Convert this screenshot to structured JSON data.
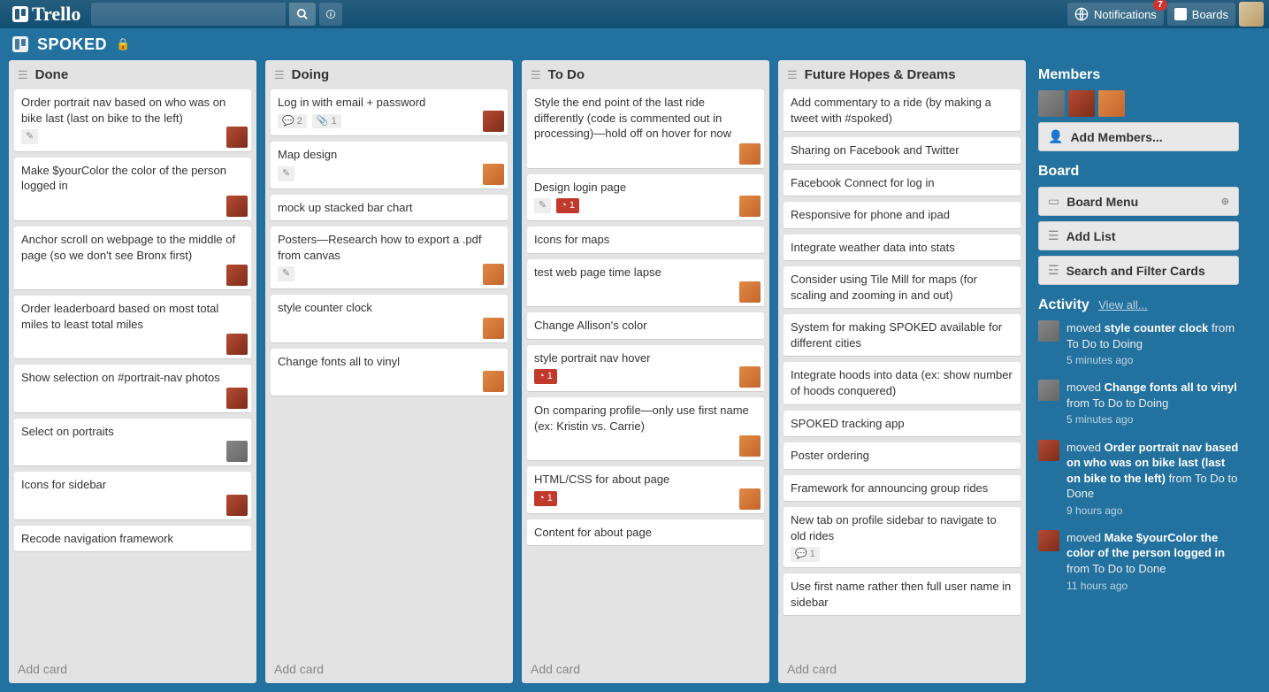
{
  "header": {
    "logo_text": "Trello",
    "notifications_label": "Notifications",
    "notifications_count": "7",
    "boards_label": "Boards"
  },
  "board": {
    "name": "SPOKED",
    "privacy": "private"
  },
  "lists": [
    {
      "title": "Done",
      "add_label": "Add card",
      "cards": [
        {
          "text": "Order portrait nav based on who was on bike last (last on bike to the left)",
          "pencil": true,
          "members": [
            "m1"
          ]
        },
        {
          "text": "Make $yourColor the color of the person logged in",
          "members": [
            "m1"
          ]
        },
        {
          "text": "Anchor scroll on webpage to the middle of page (so we don't see Bronx first)",
          "members": [
            "m1"
          ]
        },
        {
          "text": "Order leaderboard based on most total miles to least total miles",
          "members": [
            "m1"
          ]
        },
        {
          "text": "Show selection on #portrait-nav photos",
          "members": [
            "m1"
          ]
        },
        {
          "text": "Select on portraits",
          "members": [
            "m3"
          ]
        },
        {
          "text": "Icons for sidebar",
          "members": [
            "m1"
          ]
        },
        {
          "text": "Recode navigation framework"
        }
      ]
    },
    {
      "title": "Doing",
      "add_label": "Add card",
      "cards": [
        {
          "text": "Log in with email + password",
          "comments": "2",
          "attachments": "1",
          "members": [
            "m1"
          ]
        },
        {
          "text": "Map design",
          "pencil": true,
          "members": [
            "m2"
          ]
        },
        {
          "text": "mock up stacked bar chart"
        },
        {
          "text": "Posters—Research how to export a .pdf from canvas",
          "pencil": true,
          "members": [
            "m2"
          ]
        },
        {
          "text": "style counter clock",
          "members": [
            "m2"
          ]
        },
        {
          "text": "Change fonts all to vinyl",
          "members": [
            "m2"
          ]
        }
      ]
    },
    {
      "title": "To Do",
      "add_label": "Add card",
      "cards": [
        {
          "text": "Style the end point of the last ride differently (code is commented out in processing)—hold off on hover for now",
          "members": [
            "m2"
          ]
        },
        {
          "text": "Design login page",
          "pencil": true,
          "redbadge": "1",
          "members": [
            "m2"
          ]
        },
        {
          "text": "Icons for maps"
        },
        {
          "text": "test web page time lapse",
          "members": [
            "m2"
          ]
        },
        {
          "text": "Change Allison's color"
        },
        {
          "text": "style portrait nav hover",
          "redbadge": "1",
          "members": [
            "m2"
          ]
        },
        {
          "text": "On comparing profile—only use first name (ex: Kristin vs. Carrie)",
          "members": [
            "m2"
          ]
        },
        {
          "text": "HTML/CSS for about page",
          "redbadge": "1",
          "members": [
            "m2"
          ]
        },
        {
          "text": "Content for about page"
        }
      ]
    },
    {
      "title": "Future Hopes & Dreams",
      "add_label": "Add card",
      "cards": [
        {
          "text": "Add commentary to a ride (by making a tweet with #spoked)"
        },
        {
          "text": "Sharing on Facebook and Twitter"
        },
        {
          "text": "Facebook Connect for log in"
        },
        {
          "text": "Responsive for phone and ipad"
        },
        {
          "text": "Integrate weather data into stats"
        },
        {
          "text": "Consider using Tile Mill for maps (for scaling and zooming in and out)"
        },
        {
          "text": "System for making SPOKED available for different cities"
        },
        {
          "text": "Integrate hoods into data (ex: show number of hoods conquered)"
        },
        {
          "text": "SPOKED tracking app"
        },
        {
          "text": "Poster ordering"
        },
        {
          "text": "Framework for announcing group rides"
        },
        {
          "text": "New tab on profile sidebar to navigate to old rides",
          "comments": "1"
        },
        {
          "text": "Use first name rather then full user name in sidebar"
        }
      ]
    }
  ],
  "sidebar": {
    "members_title": "Members",
    "add_members_label": "Add Members...",
    "board_title": "Board",
    "board_menu_label": "Board Menu",
    "add_list_label": "Add List",
    "search_filter_label": "Search and Filter Cards",
    "activity_title": "Activity",
    "view_all_label": "View all...",
    "activity": [
      {
        "avatar": "m3",
        "prefix": "moved ",
        "bold": "style counter clock",
        "suffix": " from To Do to Doing",
        "time": "5 minutes ago"
      },
      {
        "avatar": "m3",
        "prefix": "moved ",
        "bold": "Change fonts all to vinyl",
        "suffix": " from To Do to Doing",
        "time": "5 minutes ago"
      },
      {
        "avatar": "m1",
        "prefix": "moved ",
        "bold": "Order portrait nav based on who was on bike last (last on bike to the left)",
        "suffix": " from To Do to Done",
        "time": "9 hours ago"
      },
      {
        "avatar": "m1",
        "prefix": "moved ",
        "bold": "Make $yourColor the color of the person logged in",
        "suffix": " from To Do to Done",
        "time": "11 hours ago"
      }
    ]
  }
}
